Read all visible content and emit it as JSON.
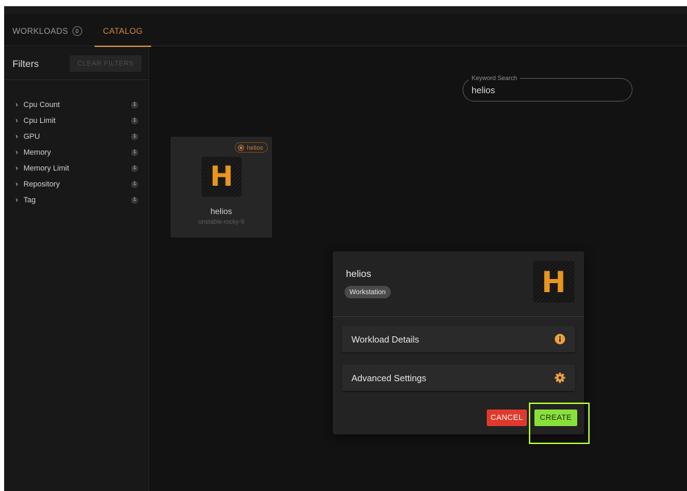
{
  "tabs": {
    "workloads_label": "WORKLOADS",
    "workloads_count": "0",
    "catalog_label": "CATALOG"
  },
  "sidebar": {
    "title": "Filters",
    "clear_label": "CLEAR FILTERS",
    "items": [
      {
        "label": "Cpu Count",
        "count": "1"
      },
      {
        "label": "Cpu Limit",
        "count": "1"
      },
      {
        "label": "GPU",
        "count": "1"
      },
      {
        "label": "Memory",
        "count": "1"
      },
      {
        "label": "Memory Limit",
        "count": "1"
      },
      {
        "label": "Repository",
        "count": "1"
      },
      {
        "label": "Tag",
        "count": "1"
      }
    ]
  },
  "search": {
    "label": "Keyword Search",
    "value": "helios"
  },
  "card": {
    "tag": "helios",
    "logo_letter": "H",
    "name": "helios",
    "subtitle": "unstable-rocky-9"
  },
  "dialog": {
    "title": "helios",
    "type": "Workstation",
    "logo_letter": "H",
    "details_label": "Workload Details",
    "advanced_label": "Advanced Settings",
    "cancel_label": "CANCEL",
    "create_label": "CREATE"
  },
  "colors": {
    "accent": "#d08a3a",
    "logo": "#e8961e",
    "cancel": "#e03a2e",
    "create": "#8ae03a",
    "highlight": "#b8ff2e"
  }
}
